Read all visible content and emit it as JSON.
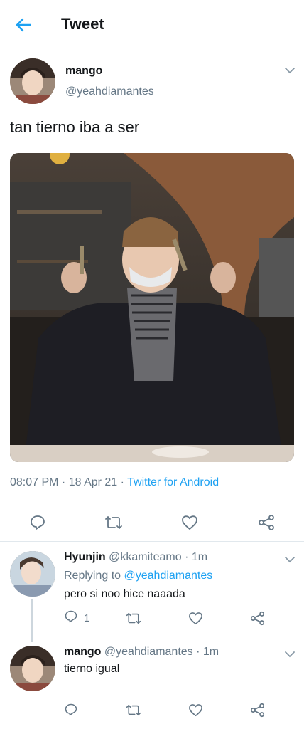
{
  "header": {
    "title": "Tweet",
    "back_icon": "back-arrow-icon"
  },
  "colors": {
    "accent": "#1da1f2",
    "secondary_text": "#657786",
    "primary_text": "#14171a",
    "divider": "#e1e8ed"
  },
  "tweet": {
    "name": "mango",
    "handle": "@yeahdiamantes",
    "text": "tan tierno iba a ser",
    "time": "08:07 PM",
    "sep": " · ",
    "date": "18 Apr 21",
    "source": "Twitter for Android",
    "image_alt": "photo of person in beanie holding utensils"
  },
  "replies": [
    {
      "name": "Hyunjin",
      "handle": "@kkamiteamo",
      "time_sep": " · ",
      "time": "1m",
      "replying_prefix": "Replying to ",
      "replying_to": "@yeahdiamantes",
      "text": "pero si noo hice naaada",
      "reply_count": "1"
    },
    {
      "name": "mango",
      "handle": "@yeahdiamantes",
      "time_sep": " · ",
      "time": "1m",
      "text": "tierno igual"
    }
  ]
}
